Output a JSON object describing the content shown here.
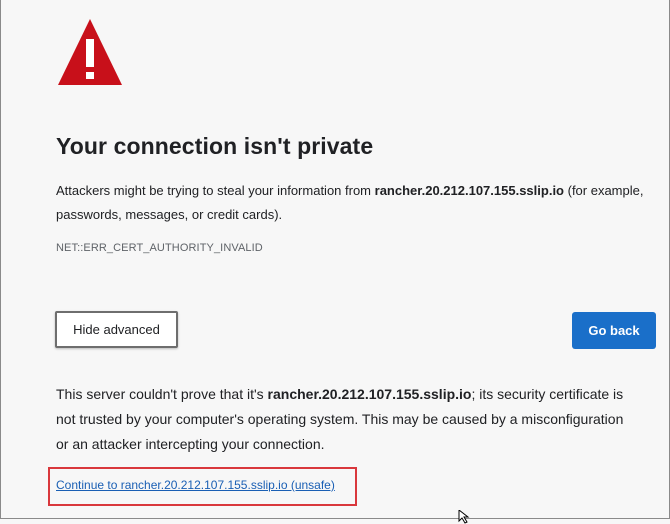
{
  "page": {
    "title": "Your connection isn't private",
    "description": {
      "before": "Attackers might be trying to steal your information from ",
      "host": "rancher.20.212.107.155.sslip.io",
      "after": " (for example, passwords, messages, or credit cards)."
    },
    "error_code": "NET::ERR_CERT_AUTHORITY_INVALID"
  },
  "buttons": {
    "hide_advanced": "Hide advanced",
    "go_back": "Go back"
  },
  "details": {
    "before": "This server couldn't prove that it's ",
    "host": "rancher.20.212.107.155.sslip.io",
    "after": "; its security certificate is not trusted by your computer's operating system. This may be caused by a misconfiguration or an attacker intercepting your connection."
  },
  "proceed_link": "Continue to rancher.20.212.107.155.sslip.io (unsafe)",
  "icons": {
    "warning": "warning-triangle-icon",
    "cursor": "mouse-cursor-icon"
  },
  "colors": {
    "warning_red": "#c8101a",
    "primary_button": "#1a6fc9",
    "link": "#1a5fb4",
    "highlight_border": "#d9373c"
  }
}
